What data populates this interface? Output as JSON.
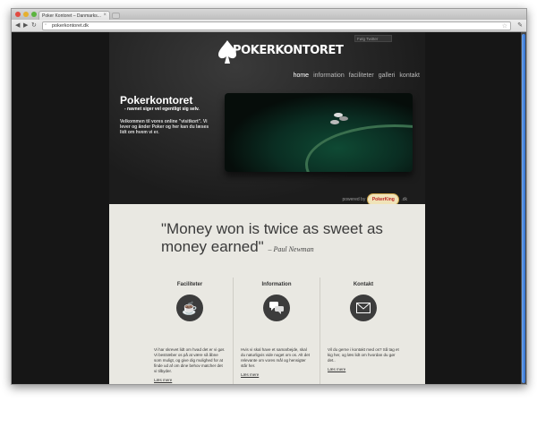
{
  "browser": {
    "tab_title": "Poker Kontoret – Danmarks...",
    "url": "pokerkontoret.dk"
  },
  "site": {
    "logo_text": "POKERKONTORET",
    "twitter_label": "Følg Twitter",
    "menu": [
      "home",
      "information",
      "faciliteter",
      "galleri",
      "kontakt"
    ],
    "hero": {
      "title": "Pokerkontoret",
      "subtitle": "- navnet siger vel egentligt sig selv.",
      "intro": "Velkommen til vores online \"visitkort\". Vi lever og ånder Poker og her kan du læses lidt om hvem vi er."
    },
    "powered_by": "powered by",
    "powered_badge": "PokerKing",
    "powered_suffix": ".dk",
    "quote": {
      "text": "\"Money won is twice as sweet as money earned\"",
      "author": "– Paul Newman"
    },
    "columns": [
      {
        "title": "Faciliteter",
        "icon": "coffee-cup-icon",
        "text": "Vi har skrevet lidt om hvad det er vi gør. Vi bestræber os på at være så åbne som muligt, og give dig mulighed for at finde ud af om dine behov matcher det vi tilbyder.",
        "link": "Læs mere"
      },
      {
        "title": "Information",
        "icon": "speech-bubbles-icon",
        "text": "Hvis vi skal have et samarbejde, skal du naturligvis vide noget om os. Alt det relevante om vores mål og hensigter står her.",
        "link": "Læs mere"
      },
      {
        "title": "Kontakt",
        "icon": "envelope-icon",
        "text": "Vil du gerne i kontakt med os? Så tag et kig her, og læs lidt om hvordan du gør det..",
        "link": "Læs mere"
      }
    ]
  }
}
